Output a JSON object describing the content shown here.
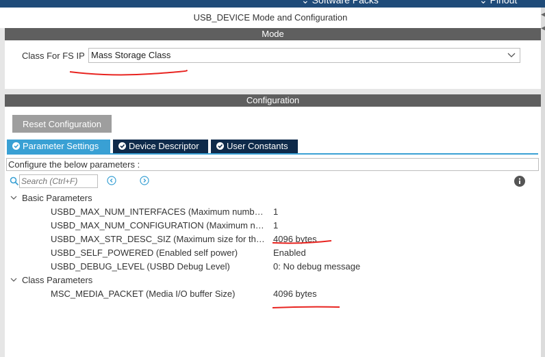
{
  "toolbar": {
    "software_packs_label": "Software Packs",
    "pinout_label": "Pinout"
  },
  "panel": {
    "title": "USB_DEVICE Mode and Configuration"
  },
  "mode": {
    "header": "Mode",
    "class_label": "Class For FS IP",
    "class_value": "Mass Storage Class"
  },
  "config": {
    "header": "Configuration",
    "reset_label": "Reset Configuration",
    "tabs": [
      {
        "label": "Parameter Settings",
        "active": true
      },
      {
        "label": "Device Descriptor",
        "active": false
      },
      {
        "label": "User Constants",
        "active": false
      }
    ],
    "description": "Configure the below parameters :",
    "search_placeholder": "Search (Ctrl+F)",
    "groups": [
      {
        "name": "Basic Parameters",
        "params": [
          {
            "name": "USBD_MAX_NUM_INTERFACES (Maximum number ...",
            "value": "1"
          },
          {
            "name": "USBD_MAX_NUM_CONFIGURATION (Maximum nu...",
            "value": "1"
          },
          {
            "name": "USBD_MAX_STR_DESC_SIZ (Maximum size for the ...",
            "value": "4096 bytes"
          },
          {
            "name": "USBD_SELF_POWERED (Enabled self power)",
            "value": "Enabled"
          },
          {
            "name": "USBD_DEBUG_LEVEL (USBD Debug Level)",
            "value": "0: No debug message"
          }
        ]
      },
      {
        "name": "Class Parameters",
        "params": [
          {
            "name": "MSC_MEDIA_PACKET (Media I/O buffer Size)",
            "value": "4096 bytes"
          }
        ]
      }
    ]
  },
  "colors": {
    "header_bg": "#5f5f5f",
    "tab_active": "#39a0d4",
    "tab_inactive": "#0e2a4a",
    "annotation_red": "#e8231f",
    "button_gray": "#9e9e9e"
  }
}
